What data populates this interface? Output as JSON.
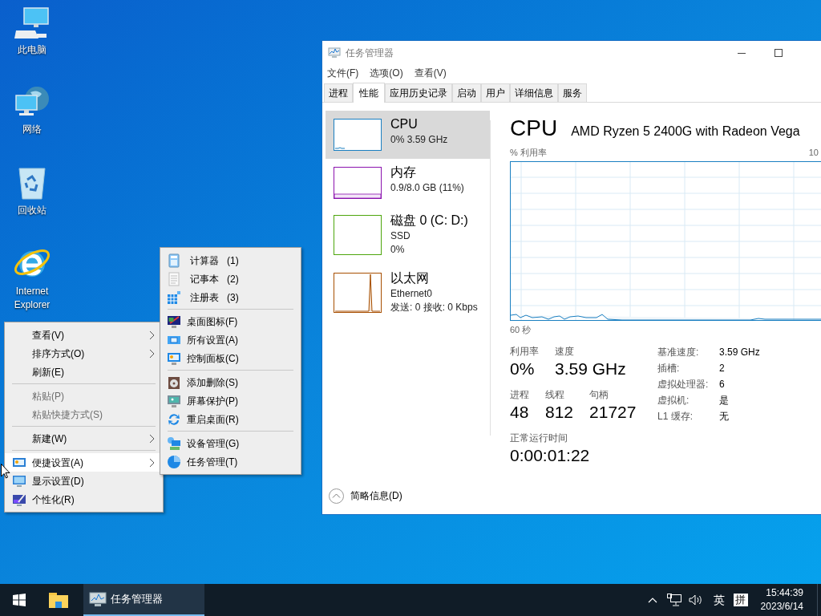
{
  "desktop_icons": [
    {
      "kind": "computer",
      "label": "此电脑"
    },
    {
      "kind": "network",
      "label": "网络"
    },
    {
      "kind": "recycle",
      "label": "回收站"
    },
    {
      "kind": "browser",
      "label": "Internet Explorer"
    }
  ],
  "context_menu": {
    "items": [
      {
        "kind": "item",
        "label": "查看(V)",
        "submenu": true,
        "disabled": false,
        "selected": false
      },
      {
        "kind": "item",
        "label": "排序方式(O)",
        "submenu": true,
        "disabled": false,
        "selected": false
      },
      {
        "kind": "item",
        "label": "刷新(E)",
        "submenu": false,
        "disabled": false,
        "selected": false
      },
      {
        "kind": "separator"
      },
      {
        "kind": "item",
        "label": "粘贴(P)",
        "submenu": false,
        "disabled": true,
        "selected": false
      },
      {
        "kind": "item",
        "label": "粘贴快捷方式(S)",
        "submenu": false,
        "disabled": true,
        "selected": false
      },
      {
        "kind": "separator"
      },
      {
        "kind": "item",
        "label": "新建(W)",
        "submenu": true,
        "disabled": false,
        "selected": false
      },
      {
        "kind": "separator"
      },
      {
        "kind": "item",
        "label": "便捷设置(A)",
        "submenu": true,
        "disabled": false,
        "selected": true
      },
      {
        "kind": "item",
        "label": "显示设置(D)",
        "submenu": false,
        "disabled": false,
        "selected": false
      },
      {
        "kind": "item",
        "label": "个性化(R)",
        "submenu": false,
        "disabled": false,
        "selected": false
      }
    ]
  },
  "submenu": {
    "items": [
      {
        "kind": "item",
        "label": "计算器",
        "shortcut": "(1)"
      },
      {
        "kind": "item",
        "label": "记事本",
        "shortcut": "(2)"
      },
      {
        "kind": "item",
        "label": "注册表",
        "shortcut": "(3)"
      },
      {
        "kind": "separator"
      },
      {
        "kind": "item",
        "label": "桌面图标(F)"
      },
      {
        "kind": "item",
        "label": "所有设置(A)"
      },
      {
        "kind": "item",
        "label": "控制面板(C)"
      },
      {
        "kind": "separator"
      },
      {
        "kind": "item",
        "label": "添加删除(S)"
      },
      {
        "kind": "item",
        "label": "屏幕保护(P)"
      },
      {
        "kind": "item",
        "label": "重启桌面(R)"
      },
      {
        "kind": "separator"
      },
      {
        "kind": "item",
        "label": "设备管理(G)"
      },
      {
        "kind": "item",
        "label": "任务管理(T)"
      }
    ]
  },
  "task_manager": {
    "title": "任务管理器",
    "menu": [
      "文件(F)",
      "选项(O)",
      "查看(V)"
    ],
    "tabs": [
      {
        "label": "进程",
        "selected": false
      },
      {
        "label": "性能",
        "selected": true
      },
      {
        "label": "应用历史记录",
        "selected": false
      },
      {
        "label": "启动",
        "selected": false
      },
      {
        "label": "用户",
        "selected": false
      },
      {
        "label": "详细信息",
        "selected": false
      },
      {
        "label": "服务",
        "selected": false
      }
    ],
    "resources": [
      {
        "name": "CPU",
        "lines": [
          "0% 3.59 GHz"
        ],
        "color": "#1a7fc1",
        "selected": true
      },
      {
        "name": "内存",
        "lines": [
          "0.9/8.0 GB (11%)"
        ],
        "color": "#8b12ae",
        "selected": false
      },
      {
        "name": "磁盘 0 (C: D:)",
        "lines": [
          "SSD",
          "0%"
        ],
        "color": "#4da60c",
        "selected": false
      },
      {
        "name": "以太网",
        "lines": [
          "Ethernet0",
          "发送: 0 接收: 0 Kbps"
        ],
        "color": "#a74f01",
        "selected": false
      }
    ],
    "detail": {
      "title": "CPU",
      "subtitle": "AMD Ryzen 5 2400G with Radeon Vega",
      "graph_label": "% 利用率",
      "graph_max": "10",
      "graph_time": "60 秒",
      "stats_row_1": [
        {
          "label": "利用率",
          "value": "0%"
        },
        {
          "label": "速度",
          "value": "3.59 GHz"
        }
      ],
      "stats_row_2": [
        {
          "label": "进程",
          "value": "48"
        },
        {
          "label": "线程",
          "value": "812"
        },
        {
          "label": "句柄",
          "value": "21727"
        }
      ],
      "uptime": {
        "label": "正常运行时间",
        "value": "0:00:01:22"
      },
      "specs": [
        {
          "label": "基准速度:",
          "value": "3.59 GHz"
        },
        {
          "label": "插槽:",
          "value": "2"
        },
        {
          "label": "虚拟处理器:",
          "value": "6"
        },
        {
          "label": "虚拟机:",
          "value": "是"
        },
        {
          "label": "L1 缓存:",
          "value": "无"
        }
      ]
    },
    "footer": "简略信息(D)"
  },
  "taskbar": {
    "buttons": [
      {
        "kind": "start",
        "active": false
      },
      {
        "kind": "folder",
        "active": false
      },
      {
        "kind": "app",
        "label": "任务管理器",
        "active": true
      }
    ],
    "ime_language": "英",
    "ime_mode": "拼",
    "time": "15:44:39",
    "date": "2023/6/14"
  }
}
